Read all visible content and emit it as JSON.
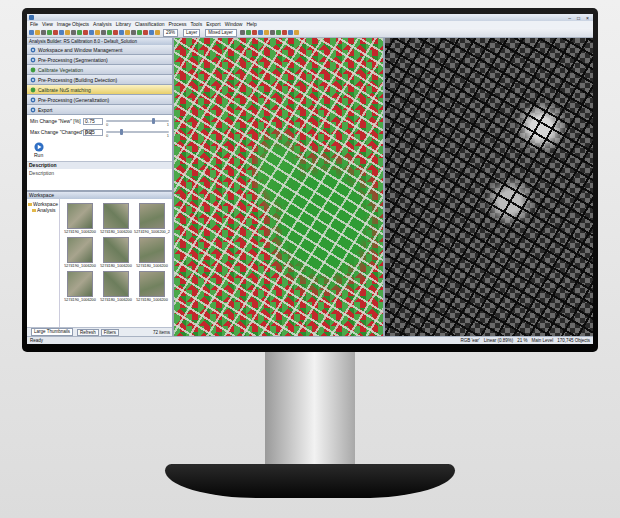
{
  "window": {
    "controls": [
      "–",
      "□",
      "×"
    ]
  },
  "menu": [
    "File",
    "View",
    "Image Objects",
    "Analysis",
    "Library",
    "Classification",
    "Process",
    "Tools",
    "Export",
    "Window",
    "Help"
  ],
  "toolbar": {
    "zoom": "29%",
    "layer": "Layer",
    "view": "Mixed Layer"
  },
  "builder": {
    "title": "Analysis Builder: RS Calibration 8.0 - Default_Solution",
    "steps": [
      {
        "label": "Workspace and Window Management",
        "kind": "group",
        "selected": false
      },
      {
        "label": "Pre-Processing (Segmentation)",
        "kind": "group",
        "selected": false
      },
      {
        "label": "Calibrate Vegetation",
        "kind": "step",
        "selected": false
      },
      {
        "label": "Pre-Processing (Building Detection)",
        "kind": "group",
        "selected": false
      },
      {
        "label": "Calibrate NuS matching",
        "kind": "step",
        "selected": true
      },
      {
        "label": "Pre-Processing (Generalization)",
        "kind": "group",
        "selected": false
      },
      {
        "label": "Export",
        "kind": "group",
        "selected": false
      }
    ],
    "parameters": [
      {
        "label": "Min Change \"New\" [%]",
        "value": "0.75",
        "min": "0",
        "max": "1",
        "level": 0.75
      },
      {
        "label": "Max Change \"Changed\" [%]",
        "value": "0.25",
        "min": "0",
        "max": "1",
        "level": 0.25
      }
    ],
    "run": "Run",
    "description": {
      "title": "Description",
      "text": "Description"
    }
  },
  "workspace": {
    "title": "Workspace",
    "tree": [
      {
        "label": "Workspace",
        "expanded": true
      },
      {
        "label": "Analysis",
        "expanded": false
      }
    ],
    "thumbnails": [
      "5274190_1006200",
      "5274180_1006200",
      "5274190_1006200_2",
      "5274190_1006200",
      "5274180_1006200",
      "5274180_1006200",
      "5274190_1006200",
      "5274180_1006200",
      "5274180_1006200"
    ],
    "view_mode": "Large Thumbnails",
    "buttons": [
      "Refresh",
      "Filters"
    ],
    "count": "72 items"
  },
  "status_bar": {
    "left": "Ready",
    "items": [
      "RGB 'ear'",
      "Linear (0.89%)",
      "21 %",
      "Main Level",
      "170,745 Objects"
    ]
  }
}
